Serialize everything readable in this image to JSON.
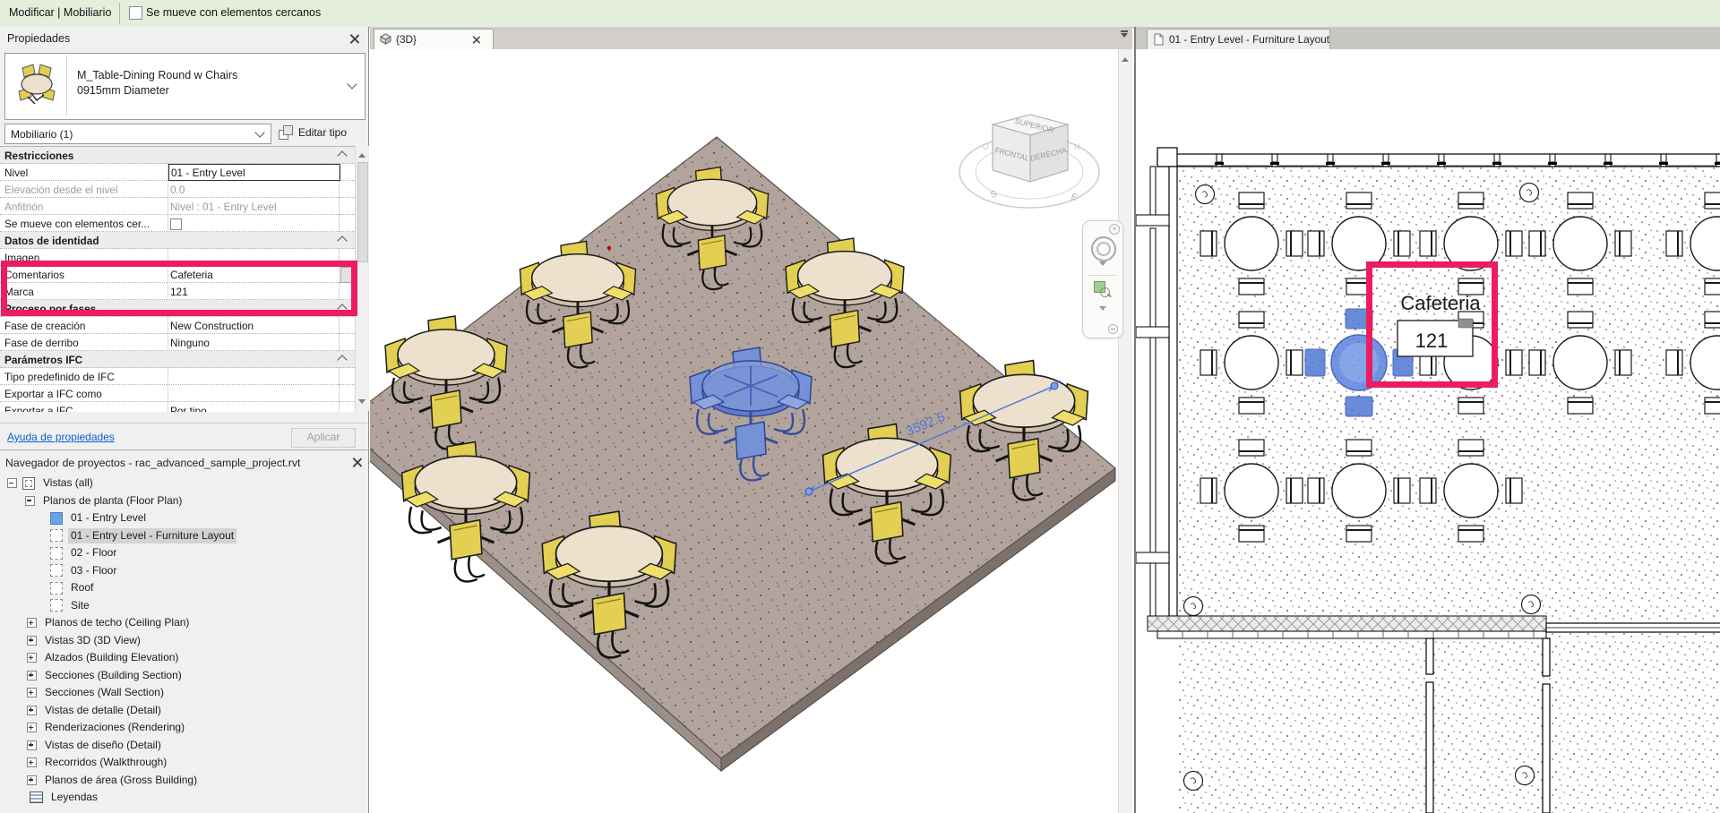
{
  "options_bar": {
    "context": "Modificar | Mobiliario",
    "move_with_nearby": "Se mueve con elementos cercanos"
  },
  "properties_panel": {
    "title": "Propiedades",
    "type_family": "M_Table-Dining Round w Chairs",
    "type_name": "0915mm Diameter",
    "category": "Mobiliario (1)",
    "edit_type": "Editar tipo",
    "rows": [
      {
        "kind": "header",
        "label": "Restricciones",
        "value": ""
      },
      {
        "kind": "row",
        "label": "Nivel",
        "value": "01 - Entry Level"
      },
      {
        "kind": "row",
        "label": "Elevación desde el nivel",
        "value": "0.0"
      },
      {
        "kind": "row",
        "label": "Anfitrión",
        "value": "Nivel : 01 - Entry Level"
      },
      {
        "kind": "checkbox",
        "label": "Se mueve con elementos cer...",
        "value": ""
      },
      {
        "kind": "header",
        "label": "Datos de identidad",
        "value": ""
      },
      {
        "kind": "row",
        "label": "Imagen",
        "value": ""
      },
      {
        "kind": "row",
        "label": "Comentarios",
        "value": "Cafeteria"
      },
      {
        "kind": "row",
        "label": "Marca",
        "value": "121"
      },
      {
        "kind": "header",
        "label": "Proceso por fases",
        "value": ""
      },
      {
        "kind": "row",
        "label": "Fase de creación",
        "value": "New Construction"
      },
      {
        "kind": "row",
        "label": "Fase de derribo",
        "value": "Ninguno"
      },
      {
        "kind": "header",
        "label": "Parámetros IFC",
        "value": ""
      },
      {
        "kind": "row",
        "label": "Tipo predefinido de IFC",
        "value": ""
      },
      {
        "kind": "row",
        "label": "Exportar a IFC como",
        "value": ""
      },
      {
        "kind": "row",
        "label": "Exportar a IFC",
        "value": "Por tipo"
      }
    ],
    "help_link": "Ayuda de propiedades",
    "apply": "Aplicar"
  },
  "project_browser": {
    "title": "Navegador de proyectos - rac_advanced_sample_project.rvt",
    "items": [
      "Vistas (all)",
      "Planos de planta (Floor Plan)",
      "01 - Entry Level",
      "01 - Entry Level - Furniture Layout",
      "02 - Floor",
      "03 - Floor",
      "Roof",
      "Site",
      "Planos de techo (Ceiling Plan)",
      "Vistas 3D (3D View)",
      "Alzados (Building Elevation)",
      "Secciones (Building Section)",
      "Secciones (Wall Section)",
      "Vistas de detalle (Detail)",
      "Renderizaciones (Rendering)",
      "Vistas de diseño (Detail)",
      "Recorridos (Walkthrough)",
      "Planos de área (Gross Building)",
      "Leyendas"
    ]
  },
  "tabs": {
    "view3d": "{3D}",
    "plan": "01 - Entry Level - Furniture Layout"
  },
  "scene3d": {
    "dimension_value": "3592.5",
    "viewcube": {
      "top": "SUPERIOR",
      "front": "FRONTAL",
      "right": "DERECHA",
      "south": "S",
      "east": "E",
      "north": "N",
      "west": "O"
    }
  },
  "plan": {
    "room_label": "Cafeteria",
    "tag_value": "121"
  },
  "colors": {
    "annotation_highlight": "#ec1c5f",
    "selection_blue": "#4f79d2",
    "options_bar_green": "#e4eedb",
    "chair_yellow": "#e3cf52",
    "table_top_cream": "#ede1cd"
  }
}
